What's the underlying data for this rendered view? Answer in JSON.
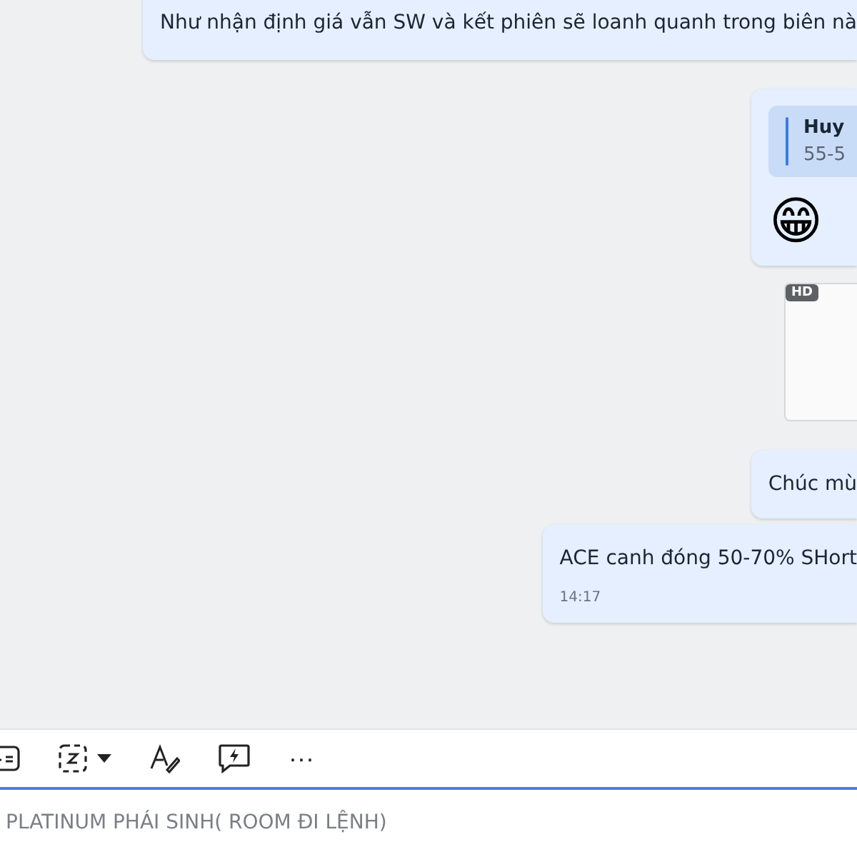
{
  "messages": [
    {
      "kind": "text",
      "text": "Như nhận định giá vẫn SW và kết phiên sẽ loanh quanh trong biên nà"
    },
    {
      "kind": "reply",
      "quote_author": "Huy",
      "quote_text": "55-5",
      "emoji": "😁"
    },
    {
      "kind": "image",
      "badge": "HD"
    },
    {
      "kind": "text",
      "text": "Chúc mù"
    },
    {
      "kind": "text",
      "text": "ACE canh đóng 50-70% SHort",
      "time": "14:17"
    }
  ],
  "toolbar": {
    "more": "···"
  },
  "composer": {
    "placeholder": "PLATINUM PHÁI SINH( ROOM ĐI LỆNH)"
  }
}
